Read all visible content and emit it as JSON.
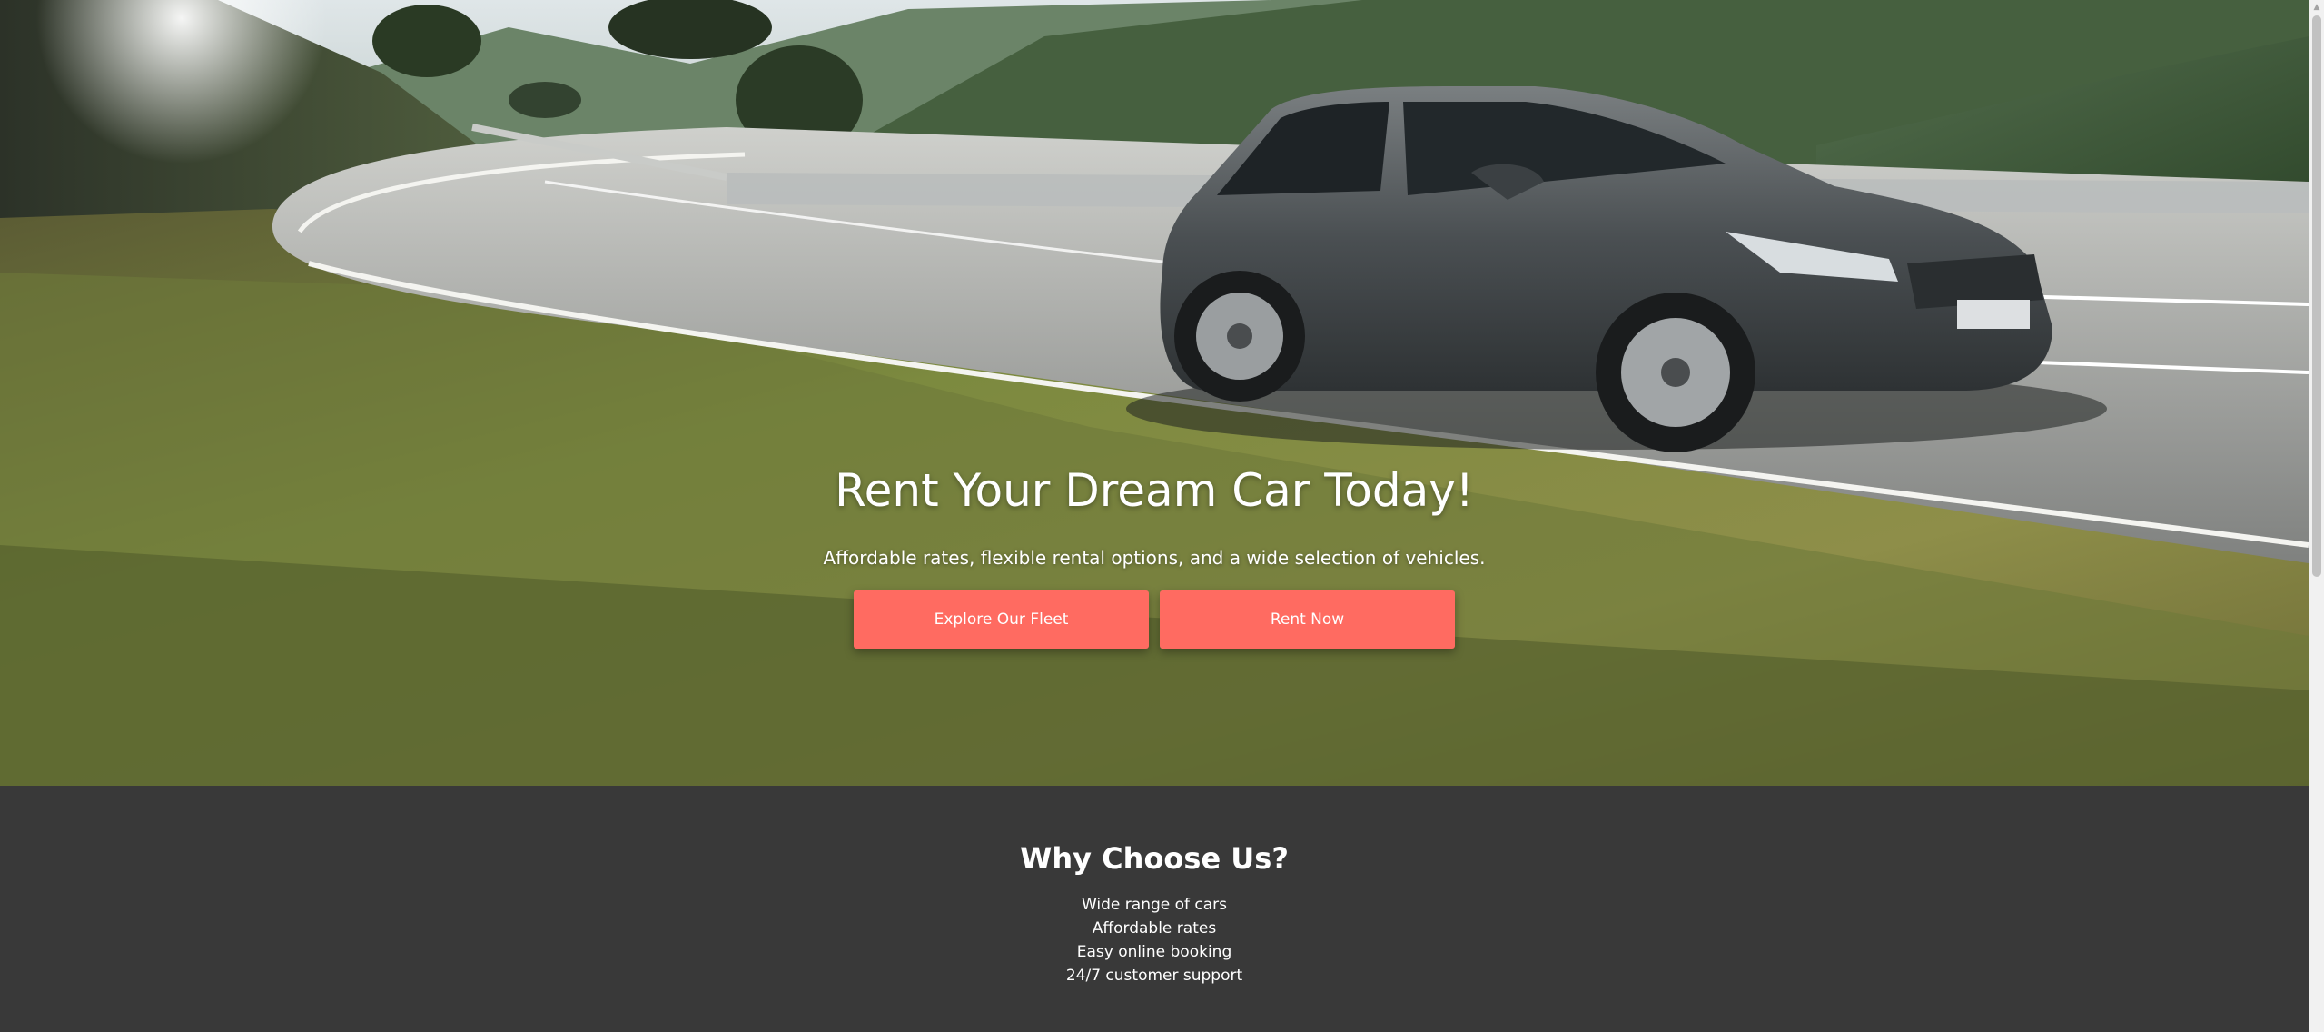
{
  "hero": {
    "title": "Rent Your Dream Car Today!",
    "subtitle": "Affordable rates, flexible rental options, and a wide selection of vehicles.",
    "buttons": [
      {
        "label": "Explore Our Fleet"
      },
      {
        "label": "Rent Now"
      }
    ],
    "background_image": "mountain-road-car-photo",
    "colors": {
      "button": "#ff6b61",
      "text": "#ffffff"
    }
  },
  "why": {
    "title": "Why Choose Us?",
    "items": [
      "Wide range of cars",
      "Affordable rates",
      "Easy online booking",
      "24/7 customer support"
    ],
    "colors": {
      "background": "#393939"
    }
  },
  "scrollbar": {
    "up_icon": "chevron-up-icon"
  }
}
